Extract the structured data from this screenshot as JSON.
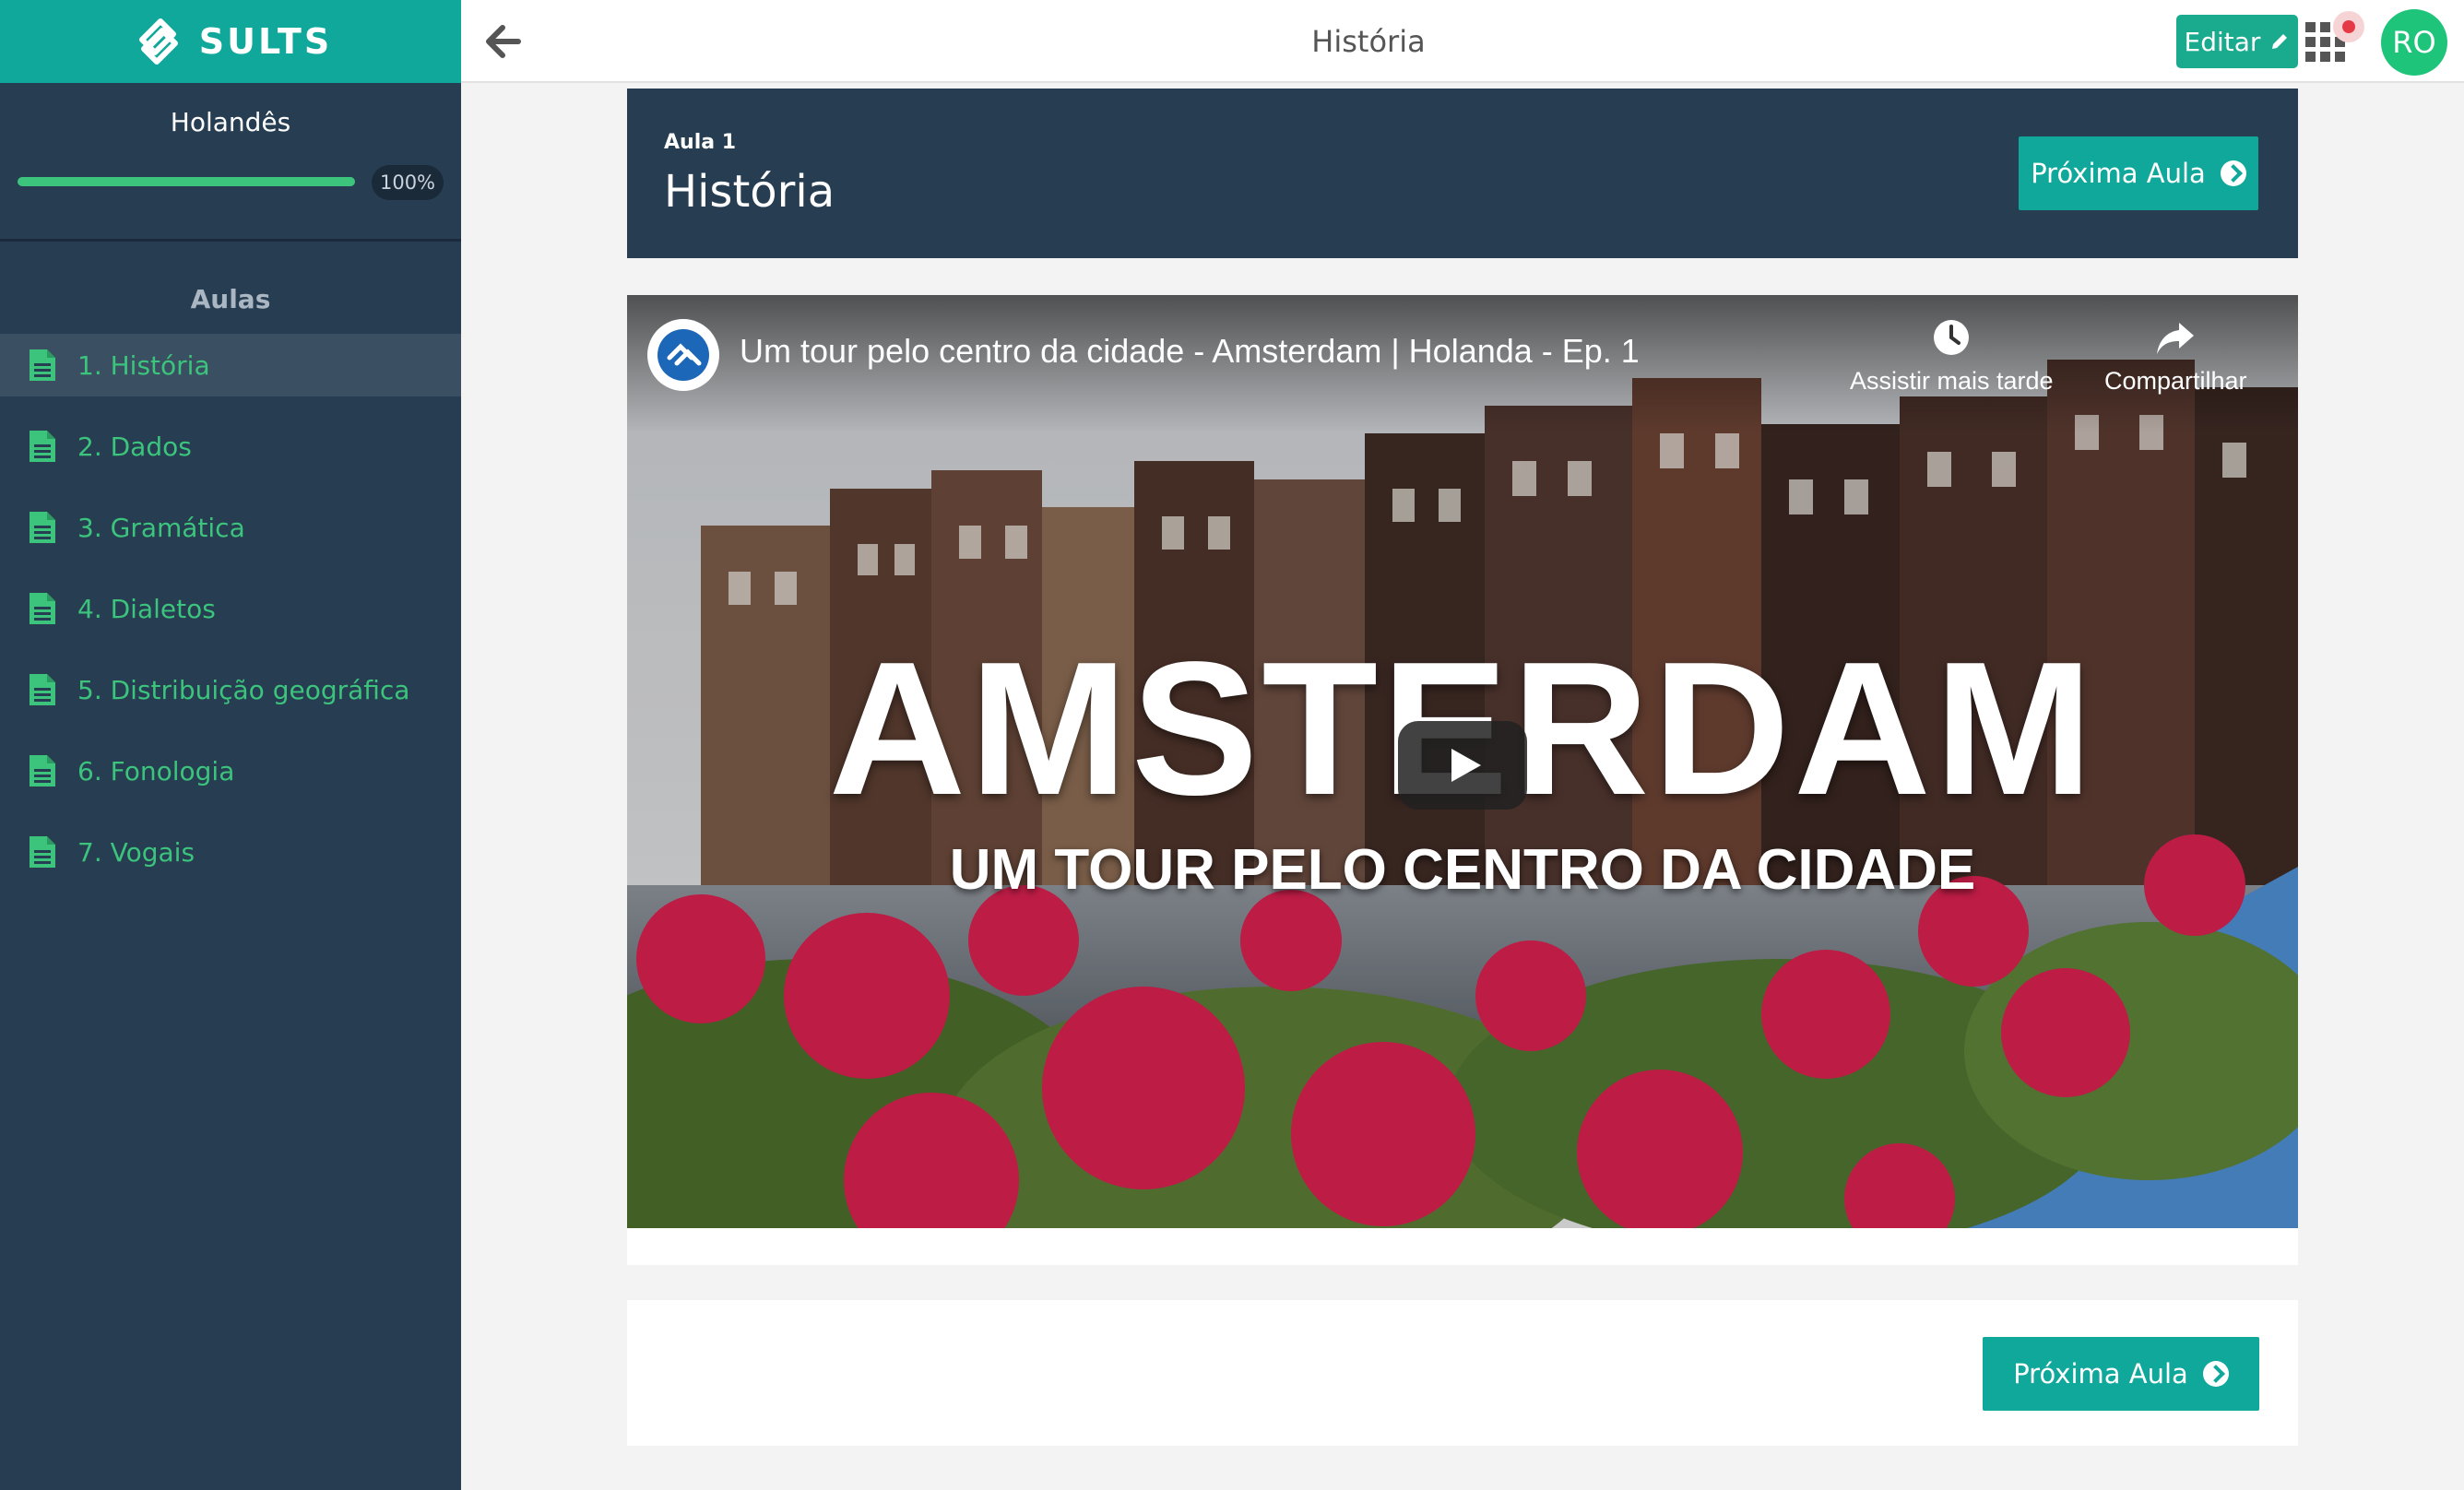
{
  "brand": {
    "name": "SULTS",
    "color": "#0fa89b"
  },
  "sidebar": {
    "course_title": "Holandês",
    "progress": {
      "value": 100,
      "label": "100%"
    },
    "lessons_heading": "Aulas",
    "lessons": [
      {
        "label": "1. História",
        "active": true
      },
      {
        "label": "2. Dados",
        "active": false
      },
      {
        "label": "3. Gramática",
        "active": false
      },
      {
        "label": "4. Dialetos",
        "active": false
      },
      {
        "label": "5. Distribuição geográfica",
        "active": false
      },
      {
        "label": "6. Fonologia",
        "active": false
      },
      {
        "label": "7. Vogais",
        "active": false
      }
    ]
  },
  "topbar": {
    "title": "História",
    "edit_label": "Editar",
    "avatar_initials": "RO",
    "icons": [
      "arrow-left-icon",
      "pencil-icon",
      "apps-grid-icon"
    ]
  },
  "lesson": {
    "eyebrow": "Aula 1",
    "title": "História",
    "next_label": "Próxima Aula"
  },
  "video": {
    "title": "Um tour pelo centro da cidade - Amsterdam | Holanda - Ep. 1",
    "watch_later": "Assistir mais tarde",
    "share": "Compartilhar",
    "overlay_title": "AMSTERDAM",
    "overlay_subtitle": "UM TOUR PELO CENTRO DA CIDADE"
  },
  "footer": {
    "next_label": "Próxima Aula"
  },
  "colors": {
    "sidebar_bg": "#263d52",
    "accent_green": "#3cc47c",
    "teal": "#0fa89b",
    "avatar": "#1fc47b"
  }
}
